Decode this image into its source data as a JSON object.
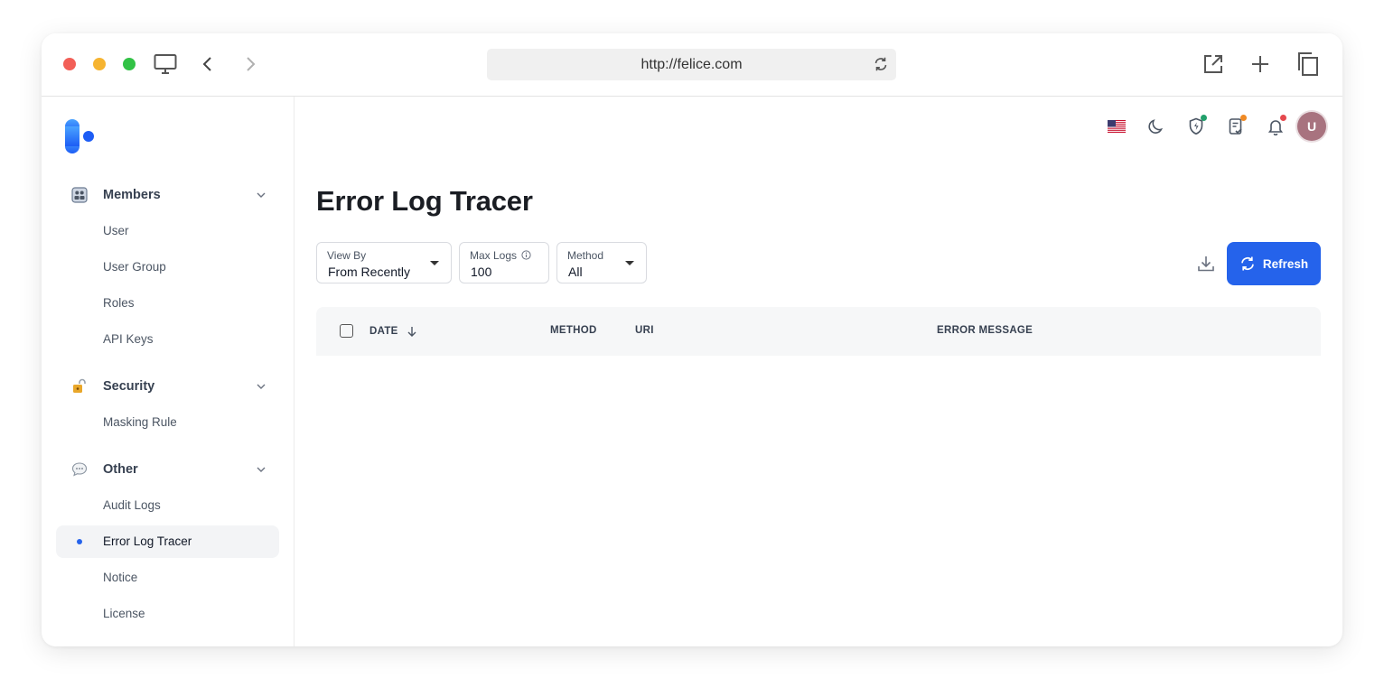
{
  "browser": {
    "url": "http://felice.com"
  },
  "sidebar": {
    "groups": [
      {
        "label": "Members",
        "icon": "members-icon",
        "items": [
          {
            "label": "User"
          },
          {
            "label": "User Group"
          },
          {
            "label": "Roles"
          },
          {
            "label": "API Keys"
          }
        ]
      },
      {
        "label": "Security",
        "icon": "lock-icon",
        "items": [
          {
            "label": "Masking Rule"
          }
        ]
      },
      {
        "label": "Other",
        "icon": "speech-bubble-icon",
        "items": [
          {
            "label": "Audit Logs"
          },
          {
            "label": "Error Log Tracer",
            "active": true
          },
          {
            "label": "Notice"
          },
          {
            "label": "License"
          }
        ]
      }
    ]
  },
  "header": {
    "avatar_initial": "U",
    "badge_colors": {
      "security": "#22a06b",
      "tasks": "#f08a24",
      "notifications": "#e5484d"
    }
  },
  "page": {
    "title": "Error Log Tracer",
    "filters": {
      "view_by": {
        "label": "View By",
        "value": "From Recently"
      },
      "max_logs": {
        "label": "Max Logs",
        "value": "100"
      },
      "method": {
        "label": "Method",
        "value": "All"
      }
    },
    "refresh_label": "Refresh",
    "table": {
      "columns": [
        "DATE",
        "METHOD",
        "URI",
        "ERROR MESSAGE"
      ],
      "rows": []
    }
  },
  "colors": {
    "accent": "#2563eb"
  }
}
